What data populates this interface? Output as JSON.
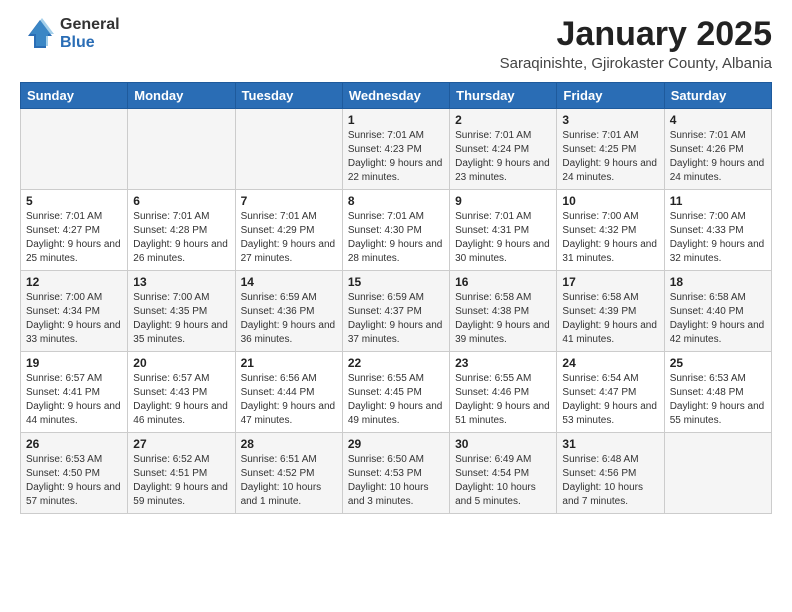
{
  "logo": {
    "general": "General",
    "blue": "Blue"
  },
  "header": {
    "title": "January 2025",
    "subtitle": "Saraqinishte, Gjirokaster County, Albania"
  },
  "weekdays": [
    "Sunday",
    "Monday",
    "Tuesday",
    "Wednesday",
    "Thursday",
    "Friday",
    "Saturday"
  ],
  "weeks": [
    [
      {
        "day": "",
        "info": ""
      },
      {
        "day": "",
        "info": ""
      },
      {
        "day": "",
        "info": ""
      },
      {
        "day": "1",
        "info": "Sunrise: 7:01 AM\nSunset: 4:23 PM\nDaylight: 9 hours and 22 minutes."
      },
      {
        "day": "2",
        "info": "Sunrise: 7:01 AM\nSunset: 4:24 PM\nDaylight: 9 hours and 23 minutes."
      },
      {
        "day": "3",
        "info": "Sunrise: 7:01 AM\nSunset: 4:25 PM\nDaylight: 9 hours and 24 minutes."
      },
      {
        "day": "4",
        "info": "Sunrise: 7:01 AM\nSunset: 4:26 PM\nDaylight: 9 hours and 24 minutes."
      }
    ],
    [
      {
        "day": "5",
        "info": "Sunrise: 7:01 AM\nSunset: 4:27 PM\nDaylight: 9 hours and 25 minutes."
      },
      {
        "day": "6",
        "info": "Sunrise: 7:01 AM\nSunset: 4:28 PM\nDaylight: 9 hours and 26 minutes."
      },
      {
        "day": "7",
        "info": "Sunrise: 7:01 AM\nSunset: 4:29 PM\nDaylight: 9 hours and 27 minutes."
      },
      {
        "day": "8",
        "info": "Sunrise: 7:01 AM\nSunset: 4:30 PM\nDaylight: 9 hours and 28 minutes."
      },
      {
        "day": "9",
        "info": "Sunrise: 7:01 AM\nSunset: 4:31 PM\nDaylight: 9 hours and 30 minutes."
      },
      {
        "day": "10",
        "info": "Sunrise: 7:00 AM\nSunset: 4:32 PM\nDaylight: 9 hours and 31 minutes."
      },
      {
        "day": "11",
        "info": "Sunrise: 7:00 AM\nSunset: 4:33 PM\nDaylight: 9 hours and 32 minutes."
      }
    ],
    [
      {
        "day": "12",
        "info": "Sunrise: 7:00 AM\nSunset: 4:34 PM\nDaylight: 9 hours and 33 minutes."
      },
      {
        "day": "13",
        "info": "Sunrise: 7:00 AM\nSunset: 4:35 PM\nDaylight: 9 hours and 35 minutes."
      },
      {
        "day": "14",
        "info": "Sunrise: 6:59 AM\nSunset: 4:36 PM\nDaylight: 9 hours and 36 minutes."
      },
      {
        "day": "15",
        "info": "Sunrise: 6:59 AM\nSunset: 4:37 PM\nDaylight: 9 hours and 37 minutes."
      },
      {
        "day": "16",
        "info": "Sunrise: 6:58 AM\nSunset: 4:38 PM\nDaylight: 9 hours and 39 minutes."
      },
      {
        "day": "17",
        "info": "Sunrise: 6:58 AM\nSunset: 4:39 PM\nDaylight: 9 hours and 41 minutes."
      },
      {
        "day": "18",
        "info": "Sunrise: 6:58 AM\nSunset: 4:40 PM\nDaylight: 9 hours and 42 minutes."
      }
    ],
    [
      {
        "day": "19",
        "info": "Sunrise: 6:57 AM\nSunset: 4:41 PM\nDaylight: 9 hours and 44 minutes."
      },
      {
        "day": "20",
        "info": "Sunrise: 6:57 AM\nSunset: 4:43 PM\nDaylight: 9 hours and 46 minutes."
      },
      {
        "day": "21",
        "info": "Sunrise: 6:56 AM\nSunset: 4:44 PM\nDaylight: 9 hours and 47 minutes."
      },
      {
        "day": "22",
        "info": "Sunrise: 6:55 AM\nSunset: 4:45 PM\nDaylight: 9 hours and 49 minutes."
      },
      {
        "day": "23",
        "info": "Sunrise: 6:55 AM\nSunset: 4:46 PM\nDaylight: 9 hours and 51 minutes."
      },
      {
        "day": "24",
        "info": "Sunrise: 6:54 AM\nSunset: 4:47 PM\nDaylight: 9 hours and 53 minutes."
      },
      {
        "day": "25",
        "info": "Sunrise: 6:53 AM\nSunset: 4:48 PM\nDaylight: 9 hours and 55 minutes."
      }
    ],
    [
      {
        "day": "26",
        "info": "Sunrise: 6:53 AM\nSunset: 4:50 PM\nDaylight: 9 hours and 57 minutes."
      },
      {
        "day": "27",
        "info": "Sunrise: 6:52 AM\nSunset: 4:51 PM\nDaylight: 9 hours and 59 minutes."
      },
      {
        "day": "28",
        "info": "Sunrise: 6:51 AM\nSunset: 4:52 PM\nDaylight: 10 hours and 1 minute."
      },
      {
        "day": "29",
        "info": "Sunrise: 6:50 AM\nSunset: 4:53 PM\nDaylight: 10 hours and 3 minutes."
      },
      {
        "day": "30",
        "info": "Sunrise: 6:49 AM\nSunset: 4:54 PM\nDaylight: 10 hours and 5 minutes."
      },
      {
        "day": "31",
        "info": "Sunrise: 6:48 AM\nSunset: 4:56 PM\nDaylight: 10 hours and 7 minutes."
      },
      {
        "day": "",
        "info": ""
      }
    ]
  ]
}
